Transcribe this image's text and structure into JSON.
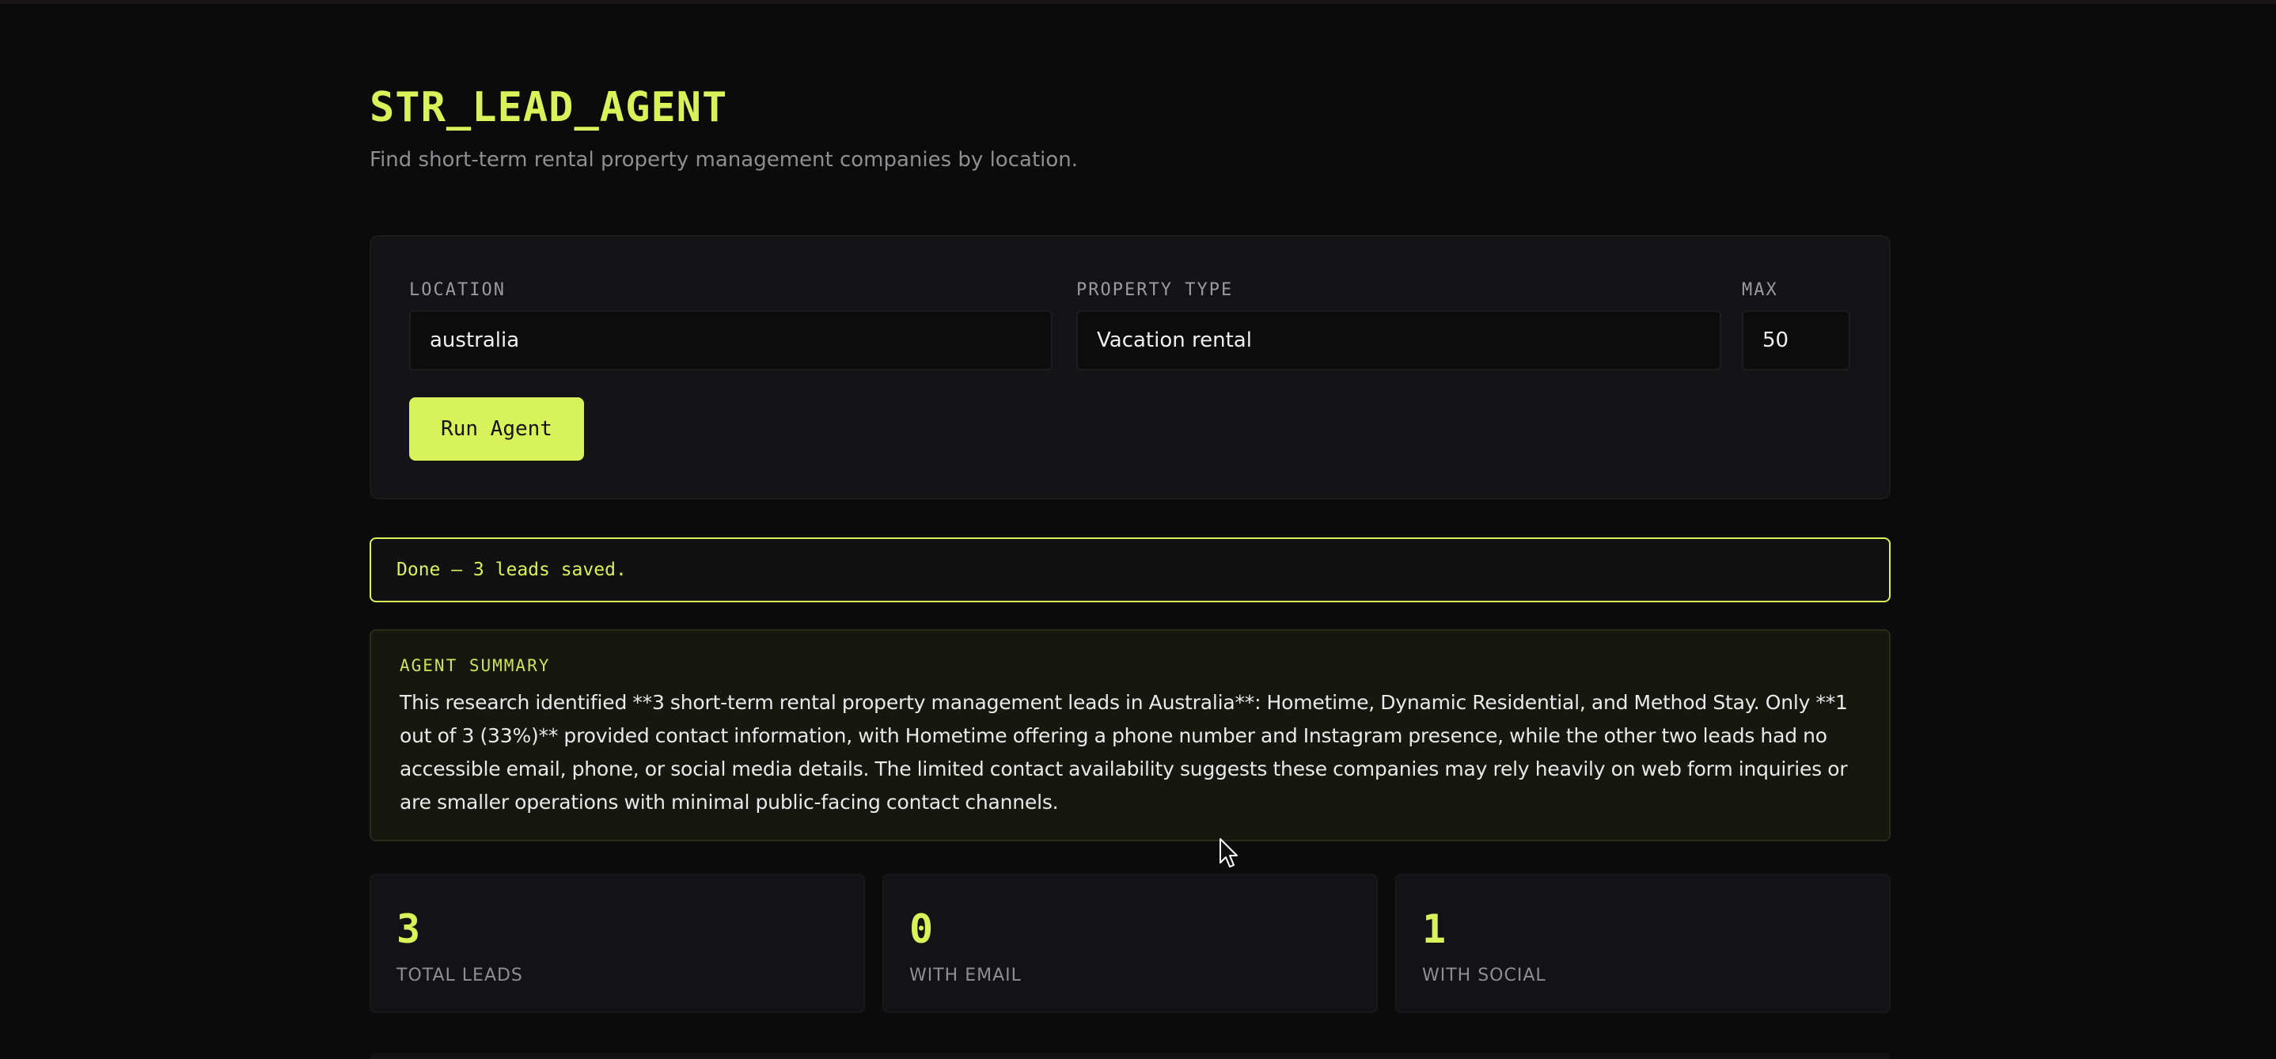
{
  "header": {
    "title": "STR_LEAD_AGENT",
    "subtitle": "Find short-term rental property management companies by location."
  },
  "form": {
    "location": {
      "label": "LOCATION",
      "value": "australia"
    },
    "property_type": {
      "label": "PROPERTY TYPE",
      "value": "Vacation rental"
    },
    "max": {
      "label": "MAX",
      "value": "50"
    },
    "run_button": "Run Agent"
  },
  "status": {
    "text": "Done — 3 leads saved.",
    "color": "#d8f25a"
  },
  "summary": {
    "label": "AGENT SUMMARY",
    "text": "This research identified **3 short-term rental property management leads in Australia**: Hometime, Dynamic Residential, and Method Stay. Only **1 out of 3 (33%)** provided contact information, with Hometime offering a phone number and Instagram presence, while the other two leads had no accessible email, phone, or social media details. The limited contact availability suggests these companies may rely heavily on web form inquiries or are smaller operations with minimal public-facing contact channels."
  },
  "stats": [
    {
      "value": "3",
      "label": "TOTAL LEADS"
    },
    {
      "value": "0",
      "label": "WITH EMAIL"
    },
    {
      "value": "1",
      "label": "WITH SOCIAL"
    }
  ],
  "colors": {
    "accent": "#d8f25a",
    "background": "#0b0b0c",
    "card": "#141416"
  },
  "icons": {
    "cursor": "mouse-pointer-icon"
  }
}
